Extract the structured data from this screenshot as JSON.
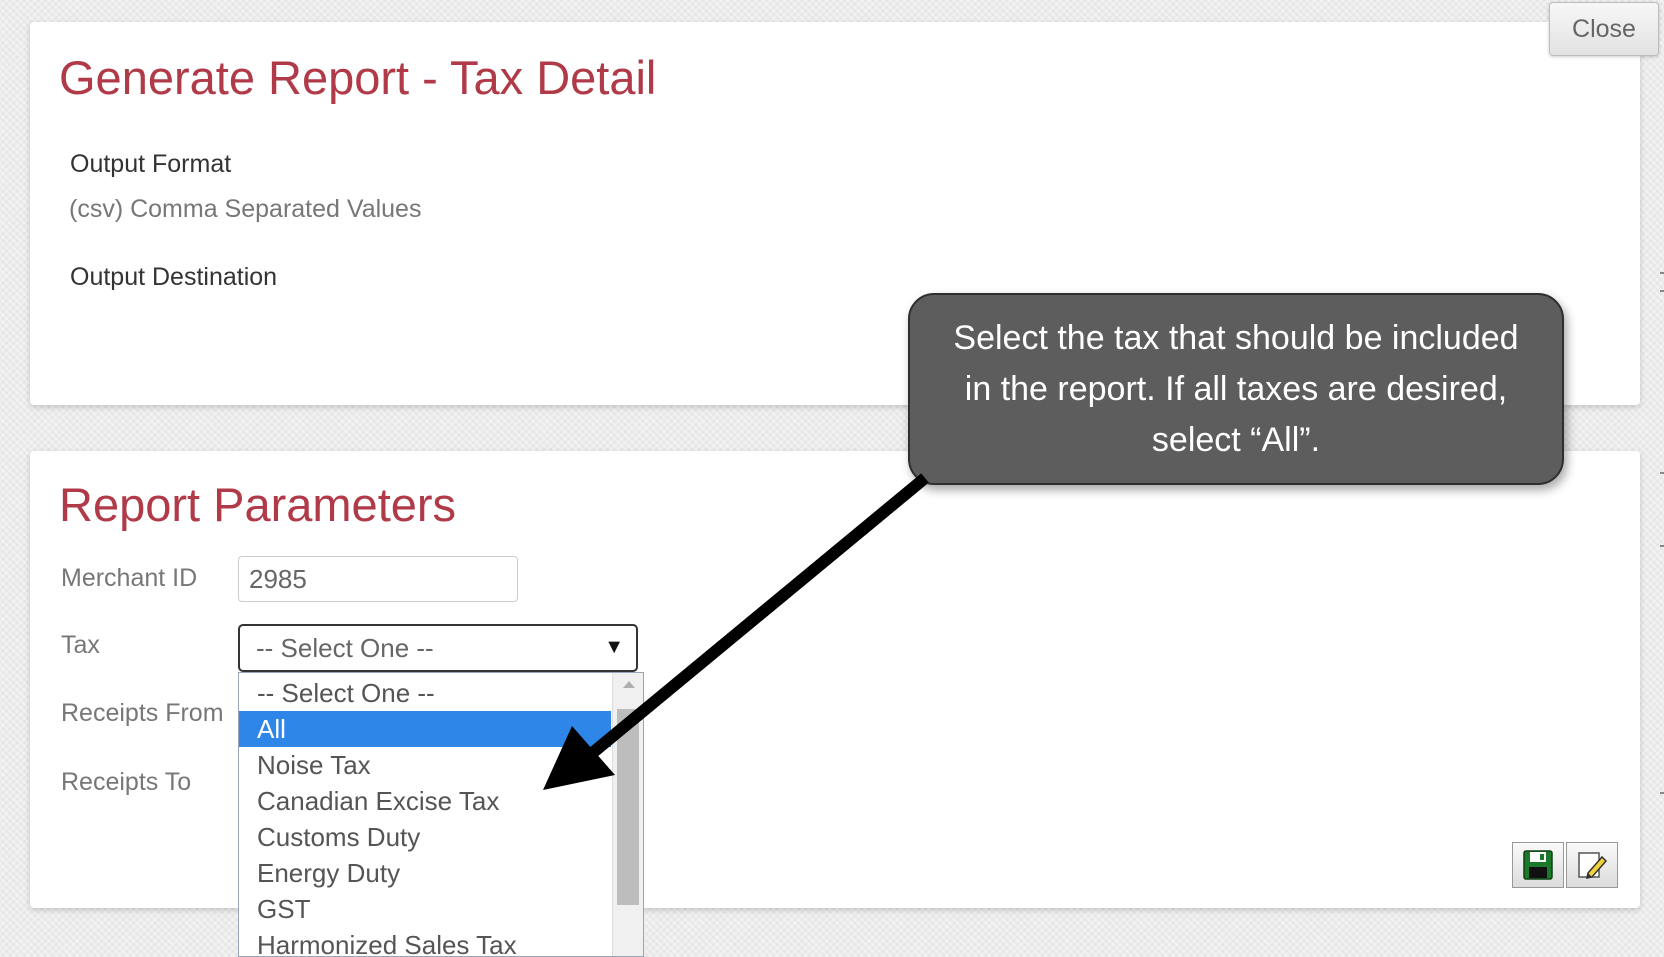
{
  "header": {
    "close_label": "Close"
  },
  "report": {
    "title": "Generate Report - Tax Detail",
    "output_format_label": "Output Format",
    "output_format_value": "(csv) Comma Separated Values",
    "output_destination_label": "Output Destination"
  },
  "parameters": {
    "title": "Report Parameters",
    "merchant_id_label": "Merchant ID",
    "merchant_id_value": "2985",
    "tax_label": "Tax",
    "tax_selected": "-- Select One --",
    "receipts_from_label": "Receipts From",
    "receipts_to_label": "Receipts To"
  },
  "tax_dropdown": {
    "options": [
      "-- Select One --",
      "All",
      "Noise Tax",
      "Canadian Excise Tax",
      "Customs Duty",
      "Energy Duty",
      "GST",
      "Harmonized Sales Tax"
    ],
    "highlighted_option": "All"
  },
  "callout": {
    "text": "Select the tax that should be included in the report. If all  taxes are desired, select “All”."
  },
  "toolbar": {
    "save_icon": "save-icon",
    "edit_icon": "edit-icon"
  },
  "colors": {
    "title_red": "#b03a48",
    "highlight_blue": "#2f86e9",
    "callout_gray": "#5d5d5d"
  }
}
